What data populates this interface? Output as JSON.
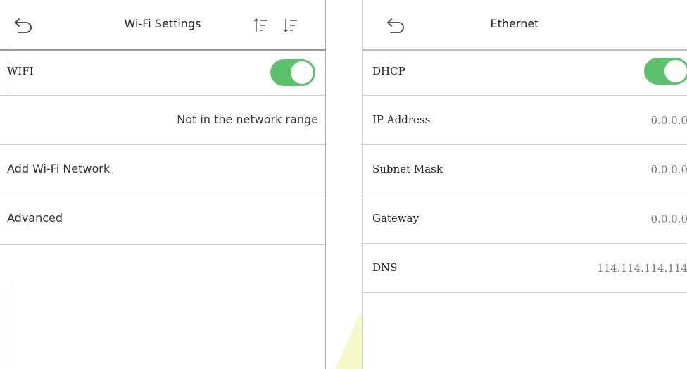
{
  "wifi_screen": {
    "title": "Wi-Fi Settings",
    "icons": {
      "back": "back-arrow-icon",
      "sort_asc": "sort-ascending-icon",
      "sort_desc": "sort-descending-icon"
    },
    "rows": {
      "wifi_label": "WIFI",
      "wifi_enabled": true,
      "status": "Not in the network range",
      "add_network": "Add Wi-Fi Network",
      "advanced": "Advanced"
    }
  },
  "ethernet_screen": {
    "title": "Ethernet",
    "icons": {
      "back": "back-arrow-icon"
    },
    "dhcp_label": "DHCP",
    "dhcp_enabled": true,
    "fields": [
      {
        "label": "IP Address",
        "value": "0.0.0.0"
      },
      {
        "label": "Subnet Mask",
        "value": "0.0.0.0"
      },
      {
        "label": "Gateway",
        "value": "0.0.0.0"
      },
      {
        "label": "DNS",
        "value": "114.114.114.114"
      }
    ]
  },
  "colors": {
    "toggle_on": "#5cc16b",
    "divider": "#cfcfcf",
    "accent_triangle": "#f7f8c8"
  }
}
